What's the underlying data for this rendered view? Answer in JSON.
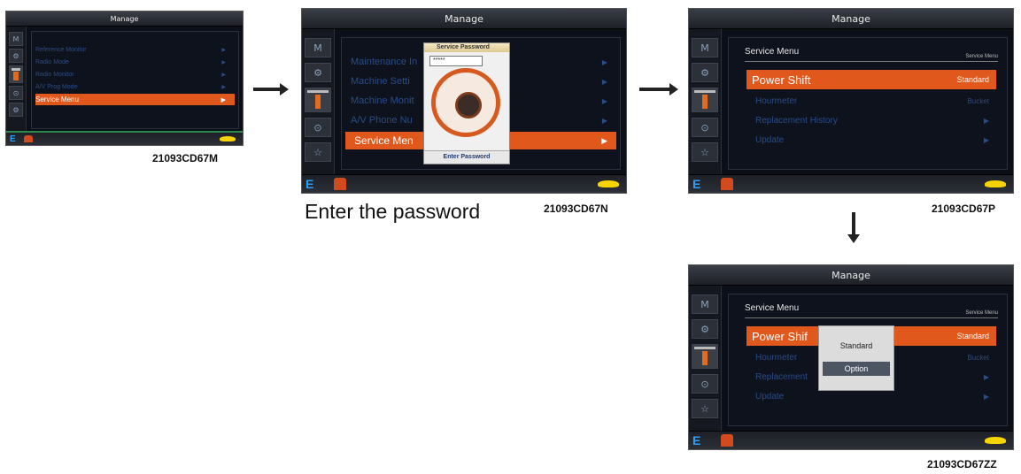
{
  "screens": {
    "m": {
      "title": "Manage",
      "sidebar": [
        "M",
        "⚙",
        "",
        "⊙",
        "⚙"
      ],
      "menu": [
        {
          "label": "Reference Monitor",
          "arrow": "▶"
        },
        {
          "label": "Radio Mode",
          "arrow": "▶"
        },
        {
          "label": "Radio Monitor",
          "arrow": "▶"
        },
        {
          "label": "A/V Prog Mode",
          "arrow": "▶"
        },
        {
          "label": "Service Menu",
          "arrow": "▶"
        }
      ],
      "bottom_e": "E",
      "caption": "21093CD67M"
    },
    "n": {
      "title": "Manage",
      "sidebar": [
        "M",
        "⚙",
        "",
        "⊙",
        "☆"
      ],
      "menu": [
        {
          "label": "Maintenance In",
          "arrow": "▶"
        },
        {
          "label": "Machine Setti",
          "arrow": "▶"
        },
        {
          "label": "Machine Monit",
          "arrow": "▶"
        },
        {
          "label": "A/V Phone Nu",
          "arrow": "▶"
        },
        {
          "label": "Service Men",
          "arrow": "▶"
        }
      ],
      "dialog": {
        "title": "Service Password",
        "value": "*****",
        "footer": "Enter Password"
      },
      "bottom_e": "E",
      "note": "Enter the password",
      "caption": "21093CD67N"
    },
    "p": {
      "title": "Manage",
      "sidebar": [
        "M",
        "⚙",
        "",
        "⊙",
        "☆"
      ],
      "header": "Service Menu",
      "header_right": "Service Menu",
      "menu": [
        {
          "label": "Power Shift",
          "value": "Standard"
        },
        {
          "label": "Hourmeter",
          "value": "Bucket"
        },
        {
          "label": "Replacement History",
          "value": "▶"
        },
        {
          "label": "Update",
          "value": "▶"
        }
      ],
      "bottom_e": "E",
      "caption": "21093CD67P"
    },
    "zz": {
      "title": "Manage",
      "sidebar": [
        "M",
        "⚙",
        "",
        "⊙",
        "☆"
      ],
      "header": "Service Menu",
      "header_right": "Service Menu",
      "menu": [
        {
          "label": "Power Shif",
          "value": "Standard"
        },
        {
          "label": "Hourmeter",
          "value": "Bucket"
        },
        {
          "label": "Replacement",
          "value": "▶"
        },
        {
          "label": "Update",
          "value": "▶"
        }
      ],
      "popup": [
        "Standard",
        "Option"
      ],
      "bottom_e": "E",
      "caption": "21093CD67ZZ"
    }
  },
  "colors": {
    "accent": "#e1581d",
    "menu_text": "#2a4c87",
    "screen_bg": "#0b0f18"
  }
}
